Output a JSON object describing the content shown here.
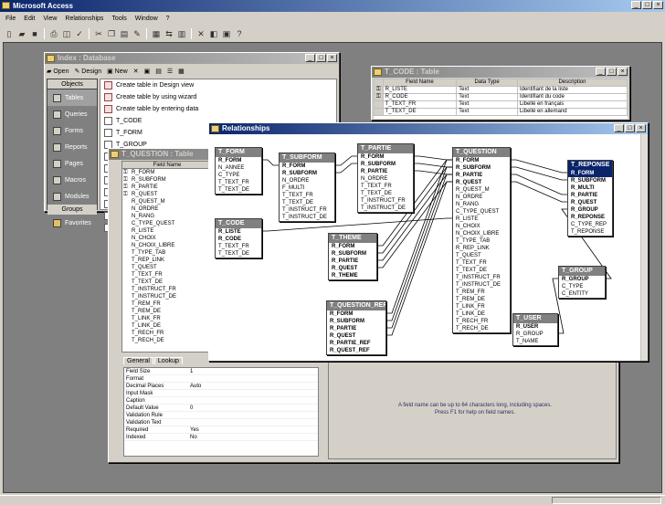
{
  "app": {
    "title": "Microsoft Access",
    "menu": [
      "File",
      "Edit",
      "View",
      "Relationships",
      "Tools",
      "Window",
      "?"
    ]
  },
  "database_window": {
    "title": "Index : Database",
    "toolbar": {
      "open": "Open",
      "design": "Design",
      "new": "New"
    },
    "objects_header": "Objects",
    "groups_header": "Groups",
    "objects": [
      "Tables",
      "Queries",
      "Forms",
      "Reports",
      "Pages",
      "Macros",
      "Modules"
    ],
    "favorites": "Favorites",
    "items": [
      "Create table in Design view",
      "Create table by using wizard",
      "Create table by entering data",
      "T_CODE",
      "T_FORM",
      "T_GROUP",
      "T_PARTIE",
      "T_QUEST",
      "T_REPONSE",
      "T_SUBFORM",
      "T_THEME",
      "T_USER",
      "T_LISTE"
    ]
  },
  "code_table": {
    "title": "T_CODE : Table",
    "columns": [
      "Field Name",
      "Data Type",
      "Description"
    ],
    "rows": [
      [
        "R_LISTE",
        "Text",
        "Identifiant de la liste"
      ],
      [
        "R_CODE",
        "Text",
        "Identifiant du code"
      ],
      [
        "T_TEXT_FR",
        "Text",
        "Libellé en français"
      ],
      [
        "T_TEXT_DE",
        "Text",
        "Libellé en allemand"
      ]
    ]
  },
  "quest_table": {
    "title": "T_QUESTION : Table",
    "field_header": "Field Name",
    "fields": [
      "R_FORM",
      "R_SUBFORM",
      "R_PARTIE",
      "R_QUEST",
      "R_QUEST_M",
      "N_ORDRE",
      "N_RANG",
      "C_TYPE_QUEST",
      "R_LISTE",
      "N_CHOIX",
      "N_CHOIX_LIBRE",
      "T_TYPE_TAB",
      "T_REP_LINK",
      "T_QUEST",
      "T_TEXT_FR",
      "T_TEXT_DE",
      "T_INSTRUCT_FR",
      "T_INSTRUCT_DE",
      "T_REM_FR",
      "T_REM_DE",
      "T_LINK_FR",
      "T_LINK_DE",
      "T_RECH_FR",
      "T_RECH_DE"
    ],
    "tabs": [
      "General",
      "Lookup"
    ],
    "props": [
      [
        "Field Size",
        "1"
      ],
      [
        "Format",
        ""
      ],
      [
        "Decimal Places",
        "Auto"
      ],
      [
        "Input Mask",
        ""
      ],
      [
        "Caption",
        ""
      ],
      [
        "Default Value",
        "0"
      ],
      [
        "Validation Rule",
        ""
      ],
      [
        "Validation Text",
        ""
      ],
      [
        "Required",
        "Yes"
      ],
      [
        "Indexed",
        "No"
      ]
    ],
    "hint": "A field name can be up to 64 characters long, including spaces. Press F1 for help on field names."
  },
  "relationships": {
    "title": "Relationships",
    "tables": [
      {
        "id": "form",
        "title": "T_FORM",
        "fields": [
          "R_FORM",
          "N_ANNEE",
          "C_TYPE",
          "T_TEXT_FR",
          "T_TEXT_DE"
        ],
        "keys": 1
      },
      {
        "id": "subform",
        "title": "T_SUBFORM",
        "fields": [
          "R_FORM",
          "R_SUBFORM",
          "N_ORDRE",
          "F_MULTI",
          "T_TEXT_FR",
          "T_TEXT_DE",
          "T_INSTRUCT_FR",
          "T_INSTRUCT_DE"
        ],
        "keys": 2
      },
      {
        "id": "partie",
        "title": "T_PARTIE",
        "fields": [
          "R_FORM",
          "R_SUBFORM",
          "R_PARTIE",
          "N_ORDRE",
          "T_TEXT_FR",
          "T_TEXT_DE",
          "T_INSTRUCT_FR",
          "T_INSTRUCT_DE"
        ],
        "keys": 3
      },
      {
        "id": "question",
        "title": "T_QUESTION",
        "fields": [
          "R_FORM",
          "R_SUBFORM",
          "R_PARTIE",
          "R_QUEST",
          "R_QUEST_M",
          "N_ORDRE",
          "N_RANG",
          "C_TYPE_QUEST",
          "R_LISTE",
          "N_CHOIX",
          "N_CHOIX_LIBRE",
          "T_TYPE_TAB",
          "R_REP_LINK",
          "T_QUEST",
          "T_TEXT_FR",
          "T_TEXT_DE",
          "T_INSTRUCT_FR",
          "T_INSTRUCT_DE",
          "T_REM_FR",
          "T_REM_DE",
          "T_LINK_FR",
          "T_LINK_DE",
          "T_RECH_FR",
          "T_RECH_DE"
        ],
        "keys": 4
      },
      {
        "id": "reponse",
        "title": "T_REPONSE",
        "fields": [
          "R_FORM",
          "R_SUBFORM",
          "R_MULTI",
          "R_PARTIE",
          "R_QUEST",
          "R_GROUP",
          "R_REPONSE",
          "C_TYPE_REP",
          "T_REPONSE"
        ],
        "keys": 7
      },
      {
        "id": "code",
        "title": "T_CODE",
        "fields": [
          "R_LISTE",
          "R_CODE",
          "T_TEXT_FR",
          "T_TEXT_DE"
        ],
        "keys": 2
      },
      {
        "id": "theme",
        "title": "T_THEME",
        "fields": [
          "R_FORM",
          "R_SUBFORM",
          "R_PARTIE",
          "R_QUEST",
          "R_THEME"
        ],
        "keys": 5
      },
      {
        "id": "group",
        "title": "T_GROUP",
        "fields": [
          "R_GROUP",
          "C_TYPE",
          "C_ENTITY"
        ],
        "keys": 1
      },
      {
        "id": "qref",
        "title": "T_QUESTION_REF",
        "fields": [
          "R_FORM",
          "R_SUBFORM",
          "R_PARTIE",
          "R_QUEST",
          "R_PARTIE_REF",
          "R_QUEST_REF"
        ],
        "keys": 6
      },
      {
        "id": "user",
        "title": "T_USER",
        "fields": [
          "R_USER",
          "R_GROUP",
          "T_NAME"
        ],
        "keys": 1
      }
    ]
  }
}
